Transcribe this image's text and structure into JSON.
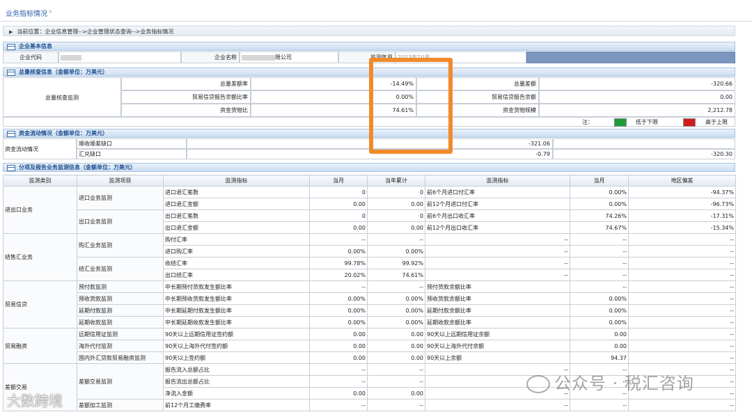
{
  "tab": {
    "title": "业务指标情况",
    "close": "×"
  },
  "breadcrumb": "当前位置：企业信息管理-->企业管理状态查询-->业务指标情况",
  "sections": {
    "basic": "企业基本信息",
    "total": "总量核查信息（金额单位：万美元）",
    "flow": "资金流动情况（金额单位：万美元）",
    "detail": "分项及报告业务监测信息（金额单位：万美元）"
  },
  "basic": {
    "code_label": "企业代码",
    "code_value": "",
    "name_label": "企业名称",
    "name_value": "限公司",
    "period_label": "监测年月",
    "period_value": "2023年10月"
  },
  "total": {
    "group": "总量核查监测",
    "rows": [
      {
        "label": "总量差额率",
        "value": "-14.49%",
        "label2": "总量差额",
        "value2": "-320.66"
      },
      {
        "label": "贸易信贷报告余额比率",
        "value": "0.00%",
        "label2": "贸易信贷报告余额",
        "value2": "0.00"
      },
      {
        "label": "资金货物比",
        "value": "74.61%",
        "label2": "资金货物规模",
        "value2": "2,212.78"
      }
    ],
    "note": "注：",
    "low": "低于下限",
    "high": "高于上限"
  },
  "colors": {
    "low": "#1f9b3a",
    "high": "#d21b1b",
    "highlight": "#f28a2b"
  },
  "flow": {
    "label": "资金流动情况",
    "rows": [
      {
        "name": "顺收顺差缺口",
        "value": "-321.06",
        "right": ""
      },
      {
        "name": "汇兑缺口",
        "value": "-0.79",
        "right": "-320.30"
      }
    ]
  },
  "detail": {
    "headers": [
      "监测类别",
      "监测项目",
      "监测指标",
      "当月",
      "当年累计",
      "监测指标",
      "当月",
      "地区偏差"
    ],
    "rows": [
      {
        "cat": "进出口业务",
        "catspan": 4,
        "proj": "进口业务监测",
        "projspan": 2,
        "ind": "进口退汇笔数",
        "m": "0",
        "y": "0",
        "ind2": "前6个月进口付汇率",
        "m2": "0.00%",
        "dev": "-94.37%"
      },
      {
        "ind": "进口退汇金额",
        "m": "0.00",
        "y": "0.00",
        "ind2": "前12个月进口付汇率",
        "m2": "0.00%",
        "dev": "-96.73%"
      },
      {
        "proj": "出口业务监测",
        "projspan": 2,
        "ind": "出口退汇笔数",
        "m": "0",
        "y": "0",
        "ind2": "前6个月出口收汇率",
        "m2": "74.26%",
        "dev": "-17.31%"
      },
      {
        "ind": "出口退汇金额",
        "m": "0.00",
        "y": "0.00",
        "ind2": "前12个月出口收汇率",
        "m2": "74.67%",
        "dev": "-15.34%"
      },
      {
        "cat": "结售汇业务",
        "catspan": 4,
        "proj": "购汇业务监测",
        "projspan": 2,
        "ind": "购付汇率",
        "m": "--",
        "y": "--",
        "ind2": "--",
        "m2": "--",
        "dev": "--"
      },
      {
        "ind": "进口购汇率",
        "m": "0.00%",
        "y": "0.00%",
        "ind2": "--",
        "m2": "--",
        "dev": "--"
      },
      {
        "proj": "结汇业务监测",
        "projspan": 2,
        "ind": "收结汇率",
        "m": "99.78%",
        "y": "99.92%",
        "ind2": "--",
        "m2": "--",
        "dev": "--"
      },
      {
        "ind": "出口结汇率",
        "m": "20.02%",
        "y": "74.61%",
        "ind2": "--",
        "m2": "--",
        "dev": "--"
      },
      {
        "cat": "贸易信贷",
        "catspan": 4,
        "proj": "预付款监测",
        "projspan": 1,
        "ind": "中长期预付货款发生额比率",
        "m": "--",
        "y": "--",
        "ind2": "预付货款余额比率",
        "m2": "--",
        "dev": "--"
      },
      {
        "proj": "预收货款监测",
        "projspan": 1,
        "ind": "中长期预收货款发生额比率",
        "m": "0.00%",
        "y": "0.00%",
        "ind2": "预收货款余额比率",
        "m2": "0.00%",
        "dev": "--"
      },
      {
        "proj": "延期付款监测",
        "projspan": 1,
        "ind": "中长期延期付款发生额比率",
        "m": "0.00%",
        "y": "0.00%",
        "ind2": "延期付款余额比率",
        "m2": "0.00%",
        "dev": "--"
      },
      {
        "proj": "延期收款监测",
        "projspan": 1,
        "ind": "中长期延期收款发生额比率",
        "m": "0.00%",
        "y": "0.00%",
        "ind2": "延期收款余额比率",
        "m2": "0.00%",
        "dev": "--"
      },
      {
        "cat": "贸易融资",
        "catspan": 3,
        "proj": "远期信用证监测",
        "projspan": 1,
        "ind": "90天以上远期信用证签约额",
        "m": "0.00",
        "y": "0.00",
        "ind2": "90天以上远期信用证余额",
        "m2": "0.00",
        "dev": "--"
      },
      {
        "proj": "海外代付监测",
        "projspan": 1,
        "ind": "90天以上海外代付签约额",
        "m": "0.00",
        "y": "0.00",
        "ind2": "90天以上海外代付余额",
        "m2": "0.00",
        "dev": "--"
      },
      {
        "proj": "国内外汇贷款贸易融资监测",
        "projspan": 1,
        "ind": "90天以上签约额",
        "m": "0.00",
        "y": "0.00",
        "ind2": "90天以上余额",
        "m2": "94.37",
        "dev": "--"
      },
      {
        "cat": "差额交易",
        "catspan": 4,
        "proj": "差额交易监测",
        "projspan": 3,
        "ind": "报告流入总额占比",
        "m": "--",
        "y": "--",
        "ind2": "--",
        "m2": "--",
        "dev": "--"
      },
      {
        "ind": "报告流出总额占比",
        "m": "--",
        "y": "--",
        "ind2": "--",
        "m2": "--",
        "dev": "--"
      },
      {
        "ind": "净流入金额",
        "m": "0.00",
        "y": "0.00",
        "ind2": "--",
        "m2": "--",
        "dev": "--"
      },
      {
        "proj": "差额加工监测",
        "projspan": 1,
        "ind": "前12个月工缴费率",
        "m": "--",
        "y": "--",
        "ind2": "--",
        "m2": "--",
        "dev": "--"
      }
    ]
  },
  "watermarks": {
    "wechat": "公众号 · 税汇咨询",
    "brand": "大数跨境"
  }
}
